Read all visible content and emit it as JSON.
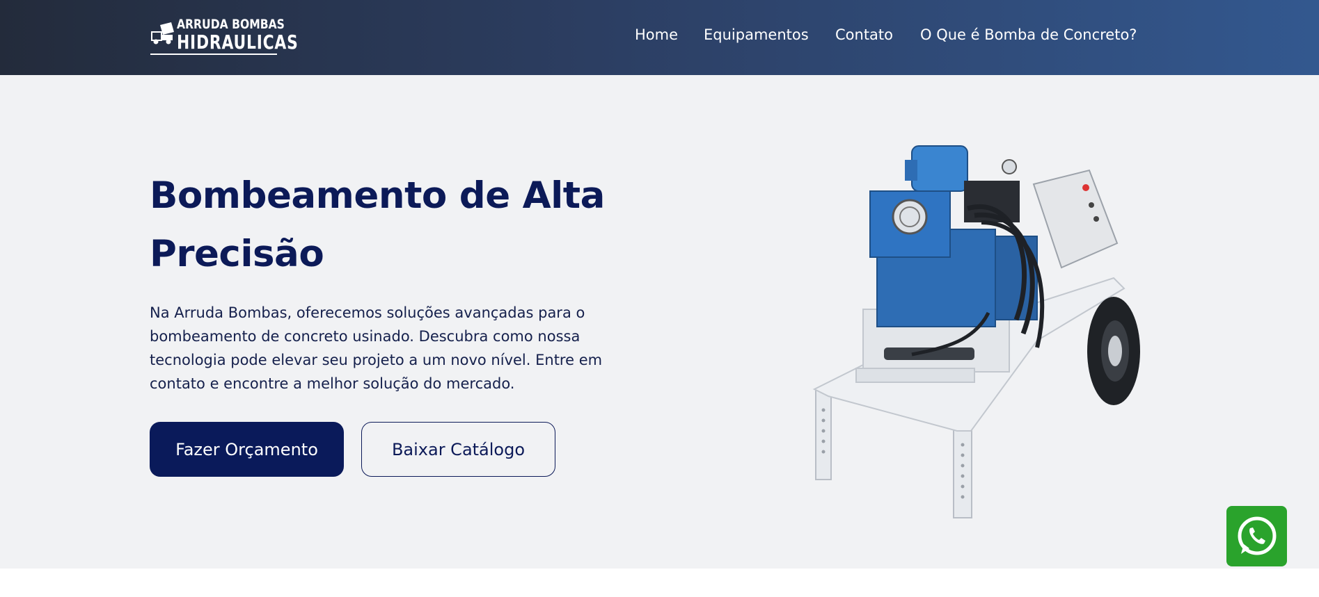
{
  "header": {
    "logo": {
      "line1": "ARRUDA BOMBAS",
      "line2": "HIDRAULICAS",
      "icon": "concrete-truck-icon"
    },
    "nav": [
      {
        "label": "Home"
      },
      {
        "label": "Equipamentos"
      },
      {
        "label": "Contato"
      },
      {
        "label": "O Que é Bomba de Concreto?"
      }
    ]
  },
  "hero": {
    "title": "Bombeamento de Alta Precisão",
    "description": "Na Arruda Bombas, oferecemos soluções avançadas para o bombeamento de concreto usinado. Descubra como nossa tecnologia pode elevar seu projeto a um novo nível. Entre em contato e encontre a melhor solução do mercado.",
    "primary_button": "Fazer Orçamento",
    "secondary_button": "Baixar Catálogo",
    "image": "concrete-pump-machine"
  },
  "floating": {
    "whatsapp_icon": "whatsapp-icon"
  },
  "colors": {
    "header_start": "#232b3b",
    "header_end": "#33588f",
    "hero_bg": "#f1f2f4",
    "brand_navy": "#0a1a5a",
    "whatsapp_green": "#2aa32c"
  }
}
